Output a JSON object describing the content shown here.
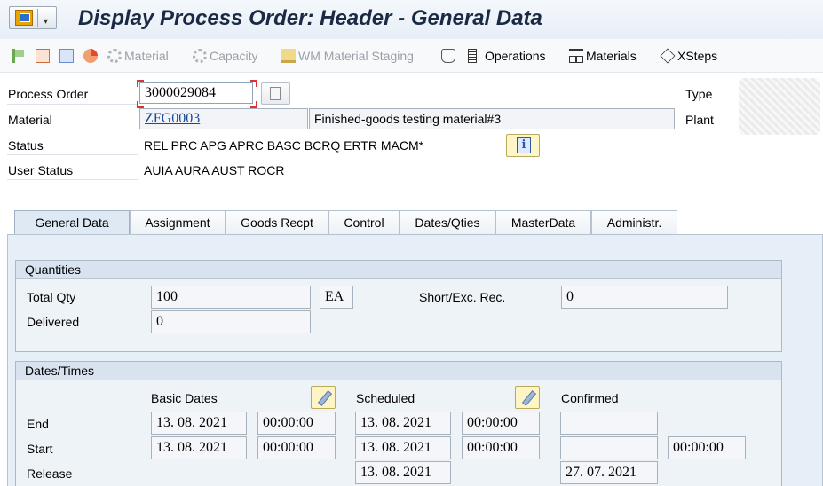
{
  "window": {
    "title": "Display Process Order: Header - General Data"
  },
  "toolbar": {
    "material": "Material",
    "capacity": "Capacity",
    "wm_staging": "WM Material Staging",
    "operations": "Operations",
    "materials": "Materials",
    "xsteps": "XSteps"
  },
  "header": {
    "process_order_label": "Process Order",
    "process_order_value": "3000029084",
    "material_label": "Material",
    "material_value": "ZFG0003",
    "material_desc": "Finished-goods testing material#3",
    "status_label": "Status",
    "status_value": "REL  PRC  APG  APRC BASC BCRQ ERTR MACM*",
    "user_status_label": "User Status",
    "user_status_value": "AUIA AURA AUST ROCR",
    "type_label": "Type",
    "plant_label": "Plant",
    "info_glyph": "i"
  },
  "tabs": [
    {
      "label": "General Data"
    },
    {
      "label": "Assignment"
    },
    {
      "label": "Goods Recpt"
    },
    {
      "label": "Control"
    },
    {
      "label": "Dates/Qties"
    },
    {
      "label": "MasterData"
    },
    {
      "label": "Administr."
    }
  ],
  "quantities": {
    "title": "Quantities",
    "total_qty_label": "Total Qty",
    "total_qty_value": "100",
    "unit": "EA",
    "short_exc_label": "Short/Exc. Rec.",
    "short_exc_value": "0",
    "delivered_label": "Delivered",
    "delivered_value": "0"
  },
  "dates": {
    "title": "Dates/Times",
    "basic_header": "Basic Dates",
    "scheduled_header": "Scheduled",
    "confirmed_header": "Confirmed",
    "end_label": "End",
    "start_label": "Start",
    "release_label": "Release",
    "end_basic_date": "13. 08. 2021",
    "end_basic_time": "00:00:00",
    "end_sched_date": "13. 08. 2021",
    "end_sched_time": "00:00:00",
    "end_conf_date": "",
    "start_basic_date": "13. 08. 2021",
    "start_basic_time": "00:00:00",
    "start_sched_date": "13. 08. 2021",
    "start_sched_time": "00:00:00",
    "start_conf_date": "",
    "start_conf_time": "00:00:00",
    "release_sched_date": "13. 08. 2021",
    "release_conf_date": "27. 07. 2021"
  }
}
